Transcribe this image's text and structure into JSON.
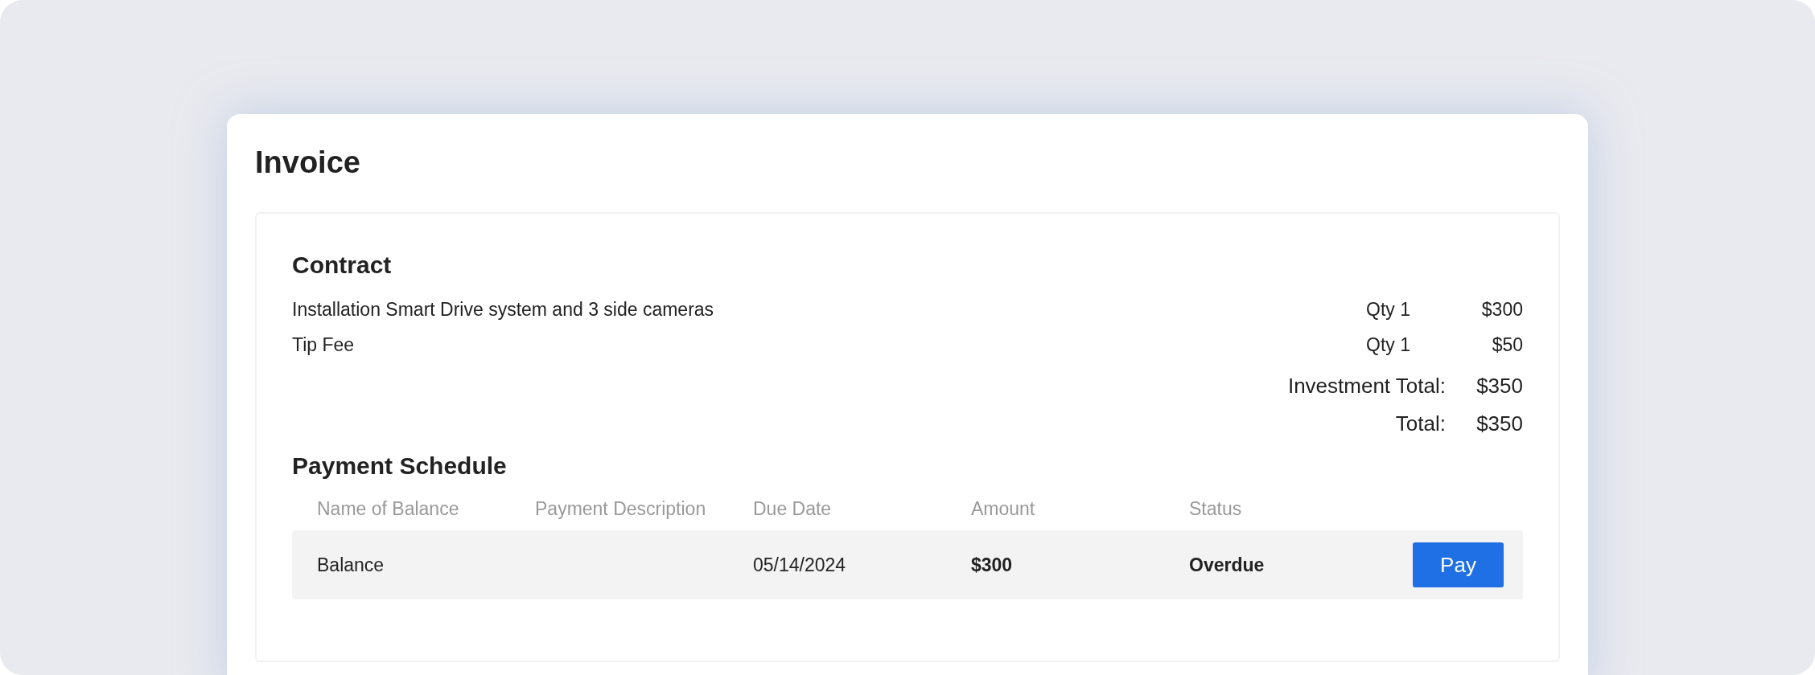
{
  "title": "Invoice",
  "contract": {
    "heading": "Contract",
    "items": [
      {
        "description": "Installation Smart Drive system and 3 side cameras",
        "qty": "Qty 1",
        "price": "$300"
      },
      {
        "description": "Tip Fee",
        "qty": "Qty 1",
        "price": "$50"
      }
    ],
    "totals": [
      {
        "label": "Investment Total:",
        "value": "$350"
      },
      {
        "label": "Total:",
        "value": "$350"
      }
    ]
  },
  "payment_schedule": {
    "heading": "Payment Schedule",
    "columns": [
      "Name of Balance",
      "Payment Description",
      "Due Date",
      "Amount",
      "Status"
    ],
    "rows": [
      {
        "name": "Balance",
        "description": "",
        "due_date": "05/14/2024",
        "amount": "$300",
        "status": "Overdue",
        "action": "Pay"
      }
    ]
  }
}
